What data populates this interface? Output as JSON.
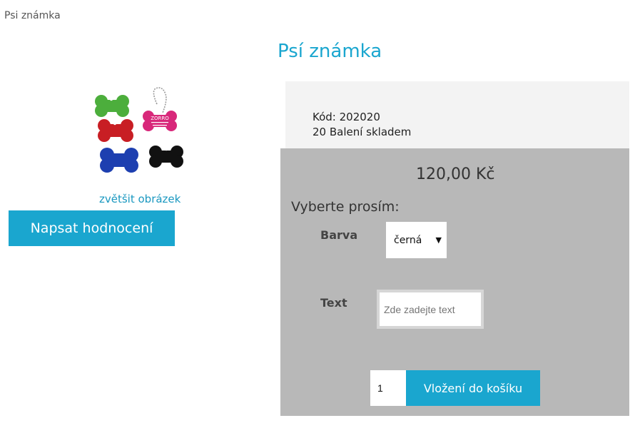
{
  "breadcrumb": "Psi známka",
  "product": {
    "title": "Psí známka",
    "zoom_link": "zvětšit obrázek",
    "review_button": "Napsat hodnocení",
    "tag_text": "ZORRO",
    "code": "Kód: 202020",
    "stock": "20 Balení skladem",
    "price": "120,00 Kč"
  },
  "options": {
    "heading": "Vyberte prosím:",
    "color_label": "Barva",
    "color_selected": "černá",
    "text_label": "Text",
    "text_placeholder": "Zde zadejte text"
  },
  "cart": {
    "quantity": "1",
    "add_button": "Vložení do košíku"
  },
  "colors": {
    "accent": "#1aa6cf",
    "panel_bg": "#b8b8b8",
    "info_bg": "#f3f3f3"
  }
}
